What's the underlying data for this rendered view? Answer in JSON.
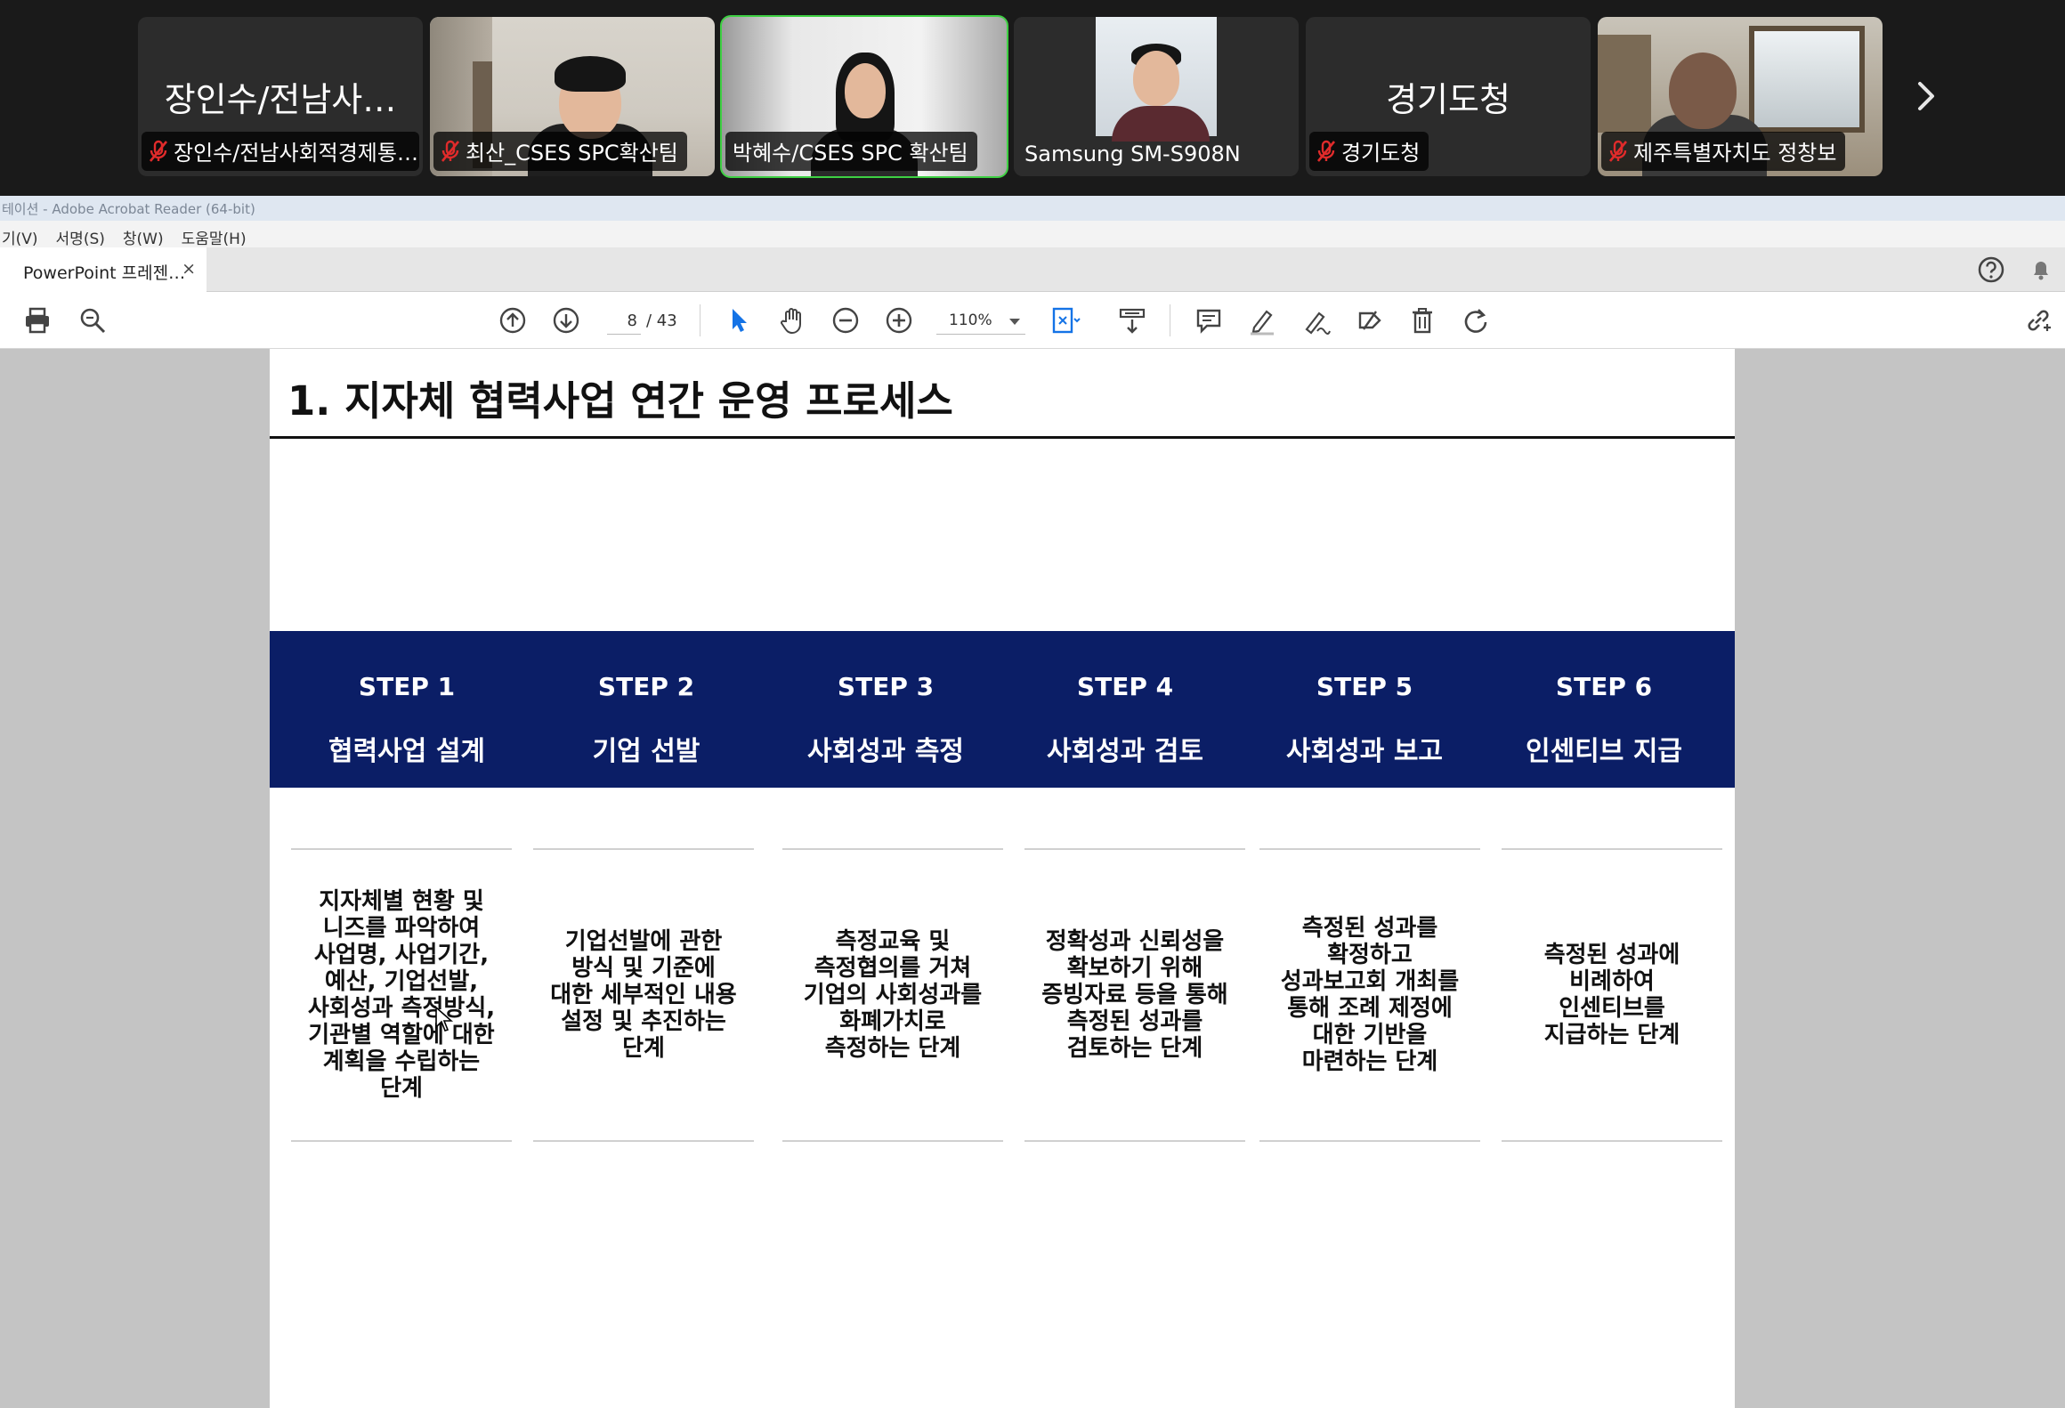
{
  "participants": [
    {
      "tile_name": "장인수/전남사…",
      "label": "장인수/전남사회적경제통…",
      "muted": true,
      "video": false,
      "active": false
    },
    {
      "tile_name": "",
      "label": "최산_CSES SPC확산팀",
      "muted": true,
      "video": true,
      "active": false
    },
    {
      "tile_name": "",
      "label": "박혜수/CSES SPC 확산팀",
      "muted": false,
      "video": true,
      "active": true
    },
    {
      "tile_name": "",
      "label": "Samsung SM-S908N",
      "muted": false,
      "video": true,
      "active": false
    },
    {
      "tile_name": "경기도청",
      "label": "경기도청",
      "muted": true,
      "video": false,
      "active": false
    },
    {
      "tile_name": "",
      "label": "제주특별자치도 정창보",
      "muted": true,
      "video": true,
      "active": false
    }
  ],
  "app": {
    "window_title": "테이션 - Adobe Acrobat Reader (64-bit)",
    "menu": [
      "기(V)",
      "서명(S)",
      "창(W)",
      "도움말(H)"
    ],
    "tab_label": "PowerPoint 프레젠…",
    "tab_close": "×"
  },
  "toolbar": {
    "page_current": "8",
    "page_total": "/ 43",
    "zoom": "110%"
  },
  "slide": {
    "title": "1. 지자체 협력사업 연간 운영 프로세스",
    "steps": [
      {
        "number": "STEP 1",
        "label": "협력사업 설계"
      },
      {
        "number": "STEP 2",
        "label": "기업 선발"
      },
      {
        "number": "STEP 3",
        "label": "사회성과 측정"
      },
      {
        "number": "STEP 4",
        "label": "사회성과 검토"
      },
      {
        "number": "STEP 5",
        "label": "사회성과 보고"
      },
      {
        "number": "STEP 6",
        "label": "인센티브 지급"
      }
    ],
    "descriptions": [
      [
        "지자체별 현황 및",
        "니즈를 파악하여",
        "사업명, 사업기간,",
        "예산, 기업선발,",
        "사회성과 측정방식,",
        "기관별 역할에 대한",
        "계획을 수립하는",
        "단계"
      ],
      [
        "기업선발에 관한",
        "방식 및 기준에",
        "대한 세부적인 내용",
        "설정 및 추진하는",
        "단계"
      ],
      [
        "측정교육 및",
        "측정협의를 거쳐",
        "기업의 사회성과를",
        "화폐가치로",
        "측정하는 단계"
      ],
      [
        "정확성과 신뢰성을",
        "확보하기 위해",
        "증빙자료 등을 통해",
        "측정된 성과를",
        "검토하는 단계"
      ],
      [
        "측정된 성과를",
        "확정하고",
        "성과보고회 개최를",
        "통해 조례 제정에",
        "대한 기반을",
        "마련하는 단계"
      ],
      [
        "측정된 성과에",
        "비례하여",
        "인센티브를",
        "지급하는 단계"
      ]
    ]
  },
  "colors": {
    "step_band": "#0b1e66",
    "active_speaker": "#3ed043",
    "mute_icon": "#e02b2b"
  }
}
